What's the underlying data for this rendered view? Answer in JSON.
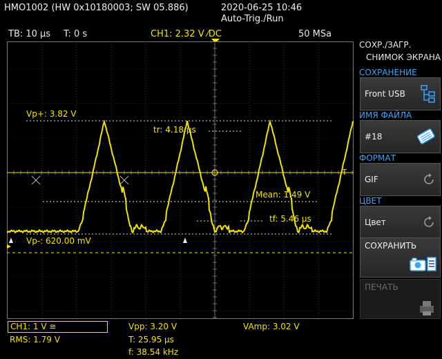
{
  "header": {
    "device": "HMO1002 (HW 0x10180003; SW 05.886)",
    "datetime": "2020-06-25 10:46",
    "mode": "Auto-Trig./Run"
  },
  "status_bar": {
    "timebase": "TB: 10 µs",
    "trigger_time": "T: 0 s",
    "channel_trigger": "CH1: 2.32 V ⁄DC",
    "sample_rate": "50 MSa"
  },
  "measurements": {
    "vp_plus": "Vp+: 3.82 V",
    "vp_minus": "Vp-: 620.00 mV",
    "rise_time": "tr: 4.18 µs",
    "fall_time": "tf: 5.46 µs",
    "mean": "Mean: 1.49 V"
  },
  "menu": {
    "title_line1": "СОХР./ЗАГР.",
    "title_line2": "СНИМОК ЭКРАНА",
    "section_save": "СОХРАНЕНИЕ",
    "save_target": "Front USB",
    "section_filename": "ИМЯ ФАЙЛА",
    "filename": "#18",
    "section_format": "ФОРМАТ",
    "format": "GIF",
    "section_color": "ЦВЕТ",
    "color": "Цвет",
    "save_button": "СОХРАНИТЬ",
    "print_button": "ПЕЧАТЬ",
    "icons": [
      "usb-tree-icon",
      "keyboard-icon",
      "rotary-knob-icon",
      "rotary-knob-icon",
      "camera-screenshot-icon",
      "printer-icon"
    ]
  },
  "bottom": {
    "ch1": "CH1: 1 V ≅",
    "rms": "RMS: 1.79 V",
    "vpp": "Vpp: 3.20 V",
    "period": "T: 25.95 µs",
    "frequency": "f: 38.54 kHz",
    "vamp": "VAmp: 3.02 V"
  },
  "colors": {
    "trace": "#f3e500",
    "menu_heading": "#3aa6ff",
    "grid": "#5a5a5a"
  },
  "waveform": {
    "pulse_centers_us": [
      -32,
      -8,
      16,
      40
    ],
    "high_v": 3.82,
    "low_v": 0.62,
    "volts_per_div": 1,
    "time_per_div_us": 10
  }
}
